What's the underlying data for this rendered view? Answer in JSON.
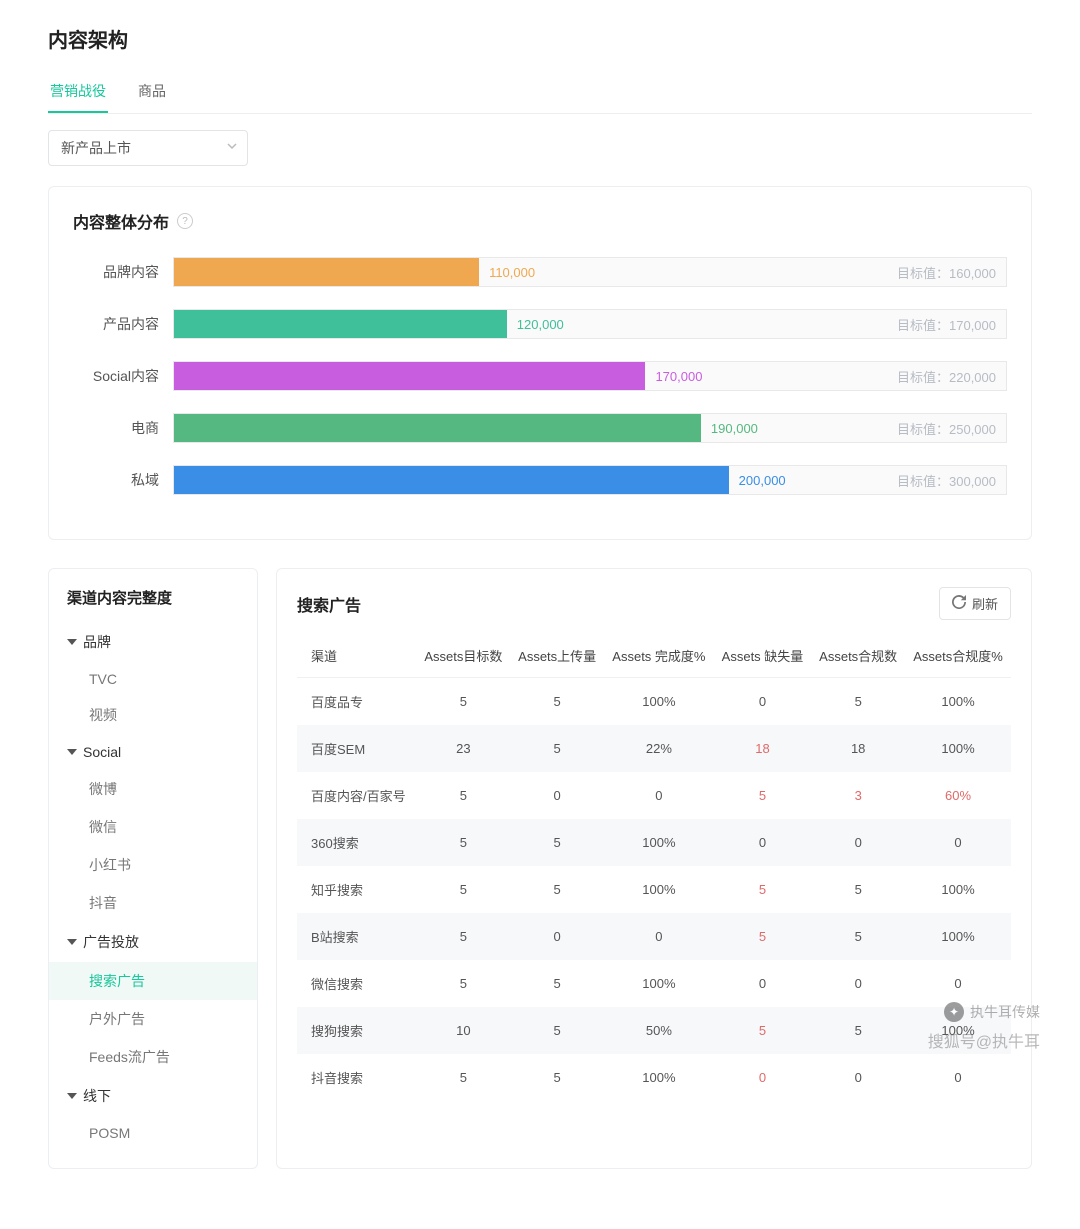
{
  "page_title": "内容架构",
  "tabs": {
    "items": [
      "营销战役",
      "商品"
    ],
    "active": 0
  },
  "selector": {
    "value": "新产品上市"
  },
  "labels": {
    "target_prefix": "目标值："
  },
  "chart_card": {
    "title": "内容整体分布"
  },
  "chart_data": {
    "type": "bar",
    "orientation": "horizontal",
    "title": "内容整体分布",
    "xlim": [
      0,
      300000
    ],
    "series": [
      {
        "name": "品牌内容",
        "value": 110000,
        "target": 160000,
        "color": "#f0a850",
        "max": 300000
      },
      {
        "name": "产品内容",
        "value": 120000,
        "target": 170000,
        "color": "#3fbf9a",
        "max": 300000
      },
      {
        "name": "Social内容",
        "value": 170000,
        "target": 220000,
        "color": "#c95de0",
        "max": 300000
      },
      {
        "name": "电商",
        "value": 190000,
        "target": 250000,
        "color": "#56b881",
        "max": 300000
      },
      {
        "name": "私域",
        "value": 200000,
        "target": 300000,
        "color": "#3a8ee6",
        "max": 300000
      }
    ]
  },
  "sidebar": {
    "title": "渠道内容完整度",
    "groups": [
      {
        "label": "品牌",
        "items": [
          "TVC",
          "视频"
        ]
      },
      {
        "label": "Social",
        "items": [
          "微博",
          "微信",
          "小红书",
          "抖音"
        ]
      },
      {
        "label": "广告投放",
        "items": [
          "搜索广告",
          "户外广告",
          "Feeds流广告"
        ],
        "active_item": 0
      },
      {
        "label": "线下",
        "items": [
          "POSM"
        ]
      }
    ]
  },
  "table": {
    "title": "搜索广告",
    "refresh_label": "刷新",
    "columns": [
      "渠道",
      "Assets目标数",
      "Assets上传量",
      "Assets 完成度%",
      "Assets 缺失量",
      "Assets合规数",
      "Assets合规度%"
    ],
    "rows": [
      {
        "cells": [
          "百度品专",
          "5",
          "5",
          "100%",
          "0",
          "5",
          "100%"
        ],
        "neg": []
      },
      {
        "cells": [
          "百度SEM",
          "23",
          "5",
          "22%",
          "18",
          "18",
          "100%"
        ],
        "neg": [
          4
        ]
      },
      {
        "cells": [
          "百度内容/百家号",
          "5",
          "0",
          "0",
          "5",
          "3",
          "60%"
        ],
        "neg": [
          4,
          5,
          6
        ]
      },
      {
        "cells": [
          "360搜索",
          "5",
          "5",
          "100%",
          "0",
          "0",
          "0"
        ],
        "neg": []
      },
      {
        "cells": [
          "知乎搜索",
          "5",
          "5",
          "100%",
          "5",
          "5",
          "100%"
        ],
        "neg": [
          4
        ]
      },
      {
        "cells": [
          "B站搜索",
          "5",
          "0",
          "0",
          "5",
          "5",
          "100%"
        ],
        "neg": [
          4
        ]
      },
      {
        "cells": [
          "微信搜索",
          "5",
          "5",
          "100%",
          "0",
          "0",
          "0"
        ],
        "neg": []
      },
      {
        "cells": [
          "搜狗搜索",
          "10",
          "5",
          "50%",
          "5",
          "5",
          "100%"
        ],
        "neg": [
          4
        ]
      },
      {
        "cells": [
          "抖音搜索",
          "5",
          "5",
          "100%",
          "0",
          "0",
          "0"
        ],
        "neg": [
          4
        ]
      }
    ]
  },
  "watermark": {
    "line1": "执牛耳传媒",
    "line2": "搜狐号@执牛耳"
  }
}
